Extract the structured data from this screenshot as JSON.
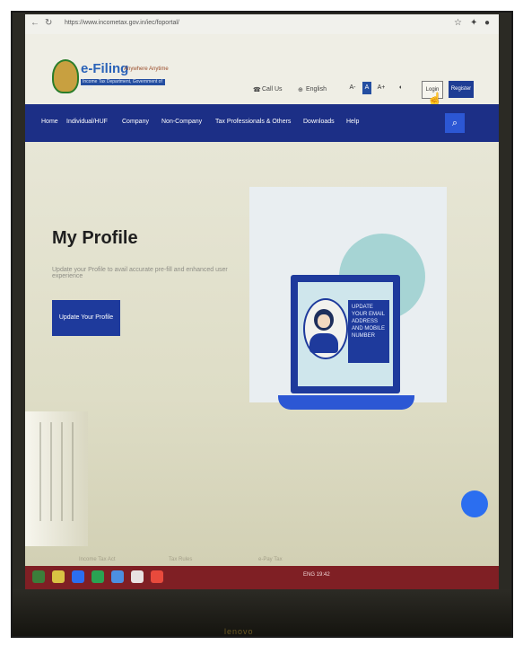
{
  "browser": {
    "url": "https://www.incometax.gov.in/iec/foportal/",
    "back_glyph": "←",
    "reload_glyph": "↻",
    "star_glyph": "☆"
  },
  "header": {
    "logo_main": "e-Filing",
    "logo_tag": "Anywhere Anytime",
    "logo_sub": "Income Tax Department, Government of India",
    "call_us": "Call Us",
    "language": "English",
    "font_minus": "A-",
    "font_normal": "A",
    "font_plus": "A+",
    "contrast": "◐",
    "login": "Login",
    "register": "Register"
  },
  "nav": {
    "items": [
      "Home",
      "Individual/HUF",
      "Company",
      "Non-Company",
      "Tax Professionals & Others",
      "Downloads",
      "Help"
    ],
    "search_glyph": "⌕"
  },
  "hero": {
    "title": "My Profile",
    "subtitle": "Update your Profile to avail accurate pre-fill and enhanced user experience",
    "button": "Update Your Profile",
    "illustration_text": "UPDATE YOUR EMAIL ADDRESS AND MOBILE NUMBER"
  },
  "footer_row": {
    "item1": "Income Tax Act",
    "item2": "Tax Rules",
    "item3": "e-Pay Tax"
  },
  "taskbar": {
    "tray_text": "ENG 19:42"
  },
  "colors": {
    "brand_blue": "#1c2f86",
    "accent_blue": "#2c57d4",
    "taskbar": "#7f1f24"
  },
  "bezel": {
    "brand": "lenovo"
  }
}
